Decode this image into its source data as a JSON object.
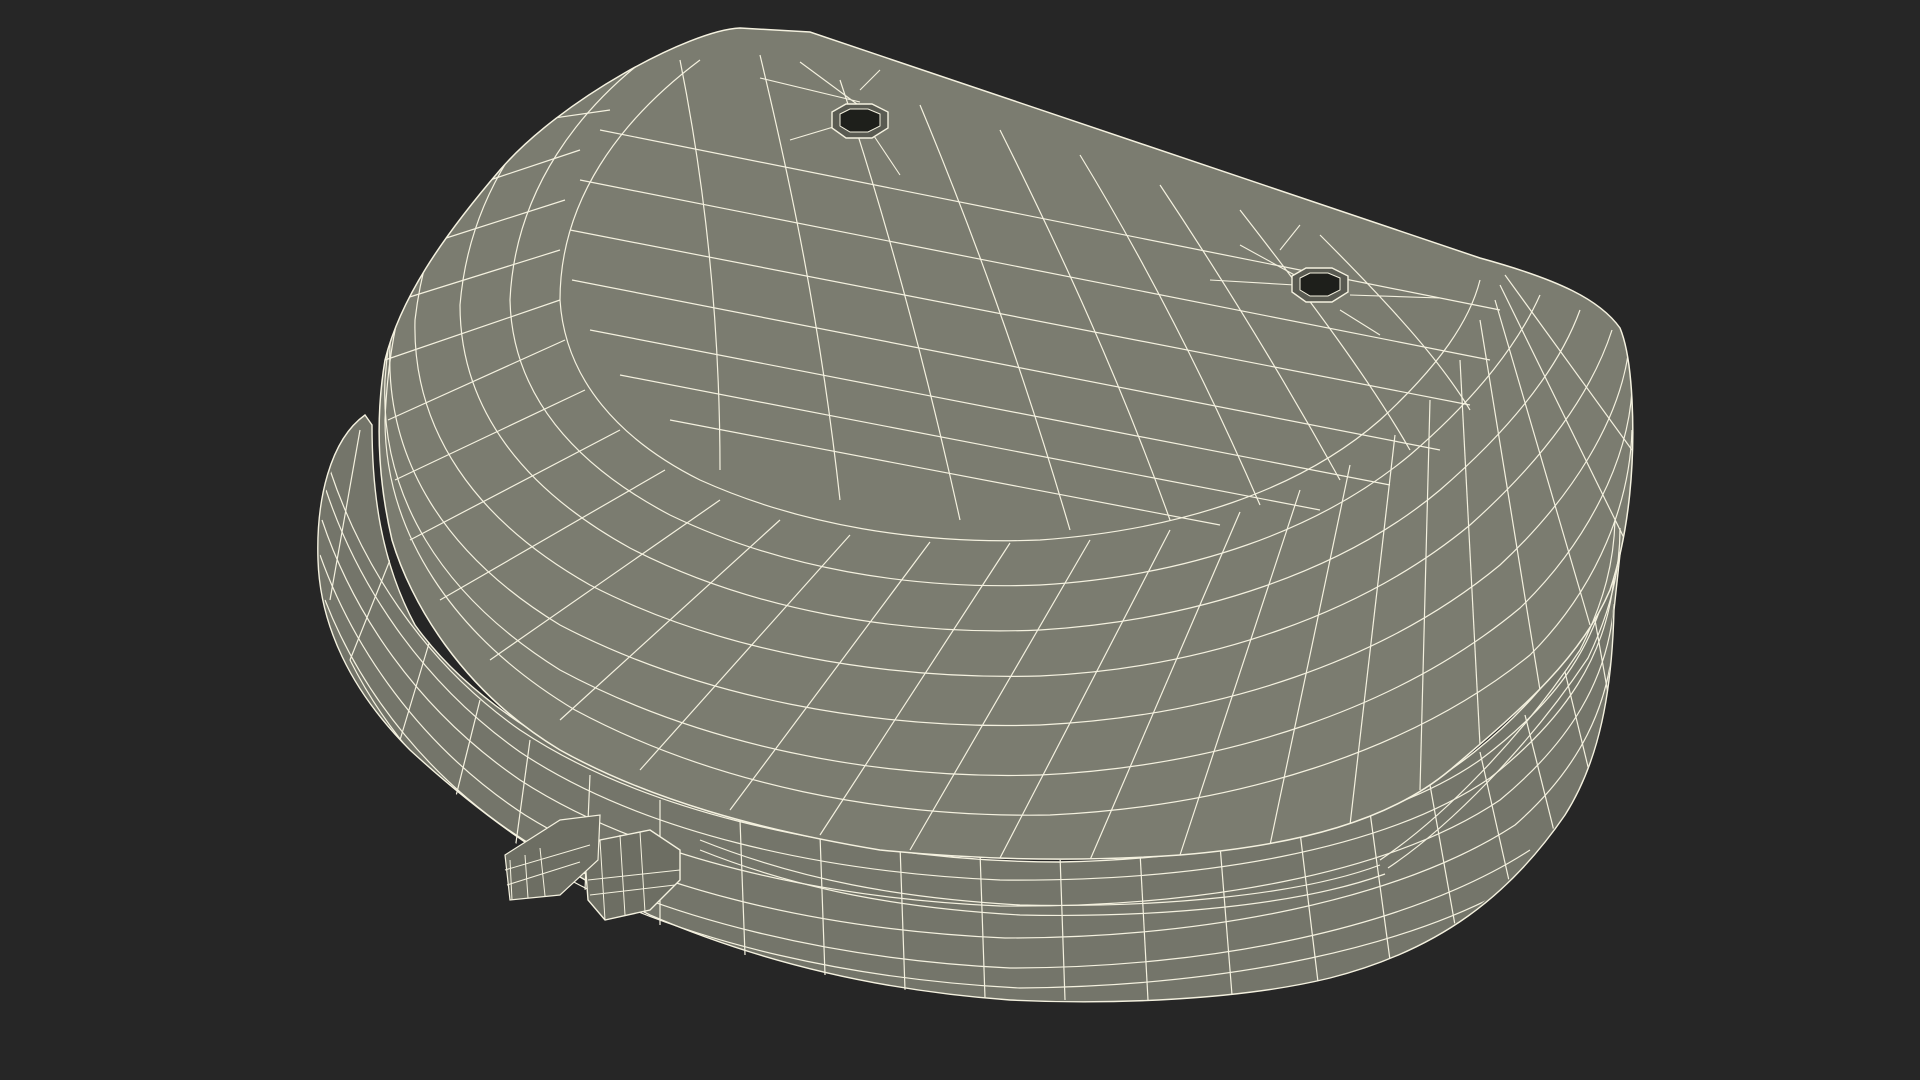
{
  "scene": {
    "subject": "retainer-case-wireframe",
    "background_color": "#262626",
    "mesh_fill_color": "#7b7c70",
    "mesh_shadow_color": "#5f6057",
    "wire_color": "#f4f1df",
    "hole_color": "#1e1f1b"
  }
}
